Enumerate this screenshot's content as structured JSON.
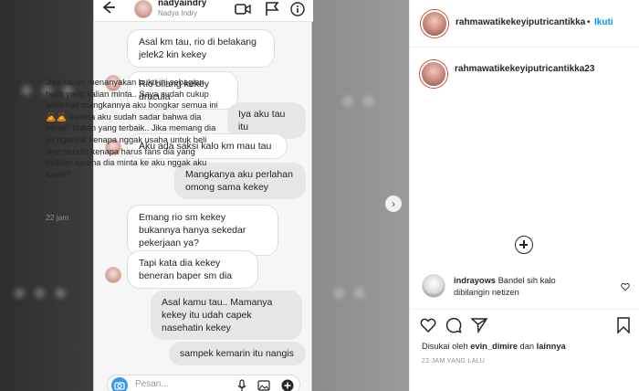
{
  "chat": {
    "header_name": "nadyaindry",
    "header_sub": "Nadya Indry",
    "messages": [
      {
        "side": "in",
        "text": "Asal km tau, rio di belakang jelek2 kin kekey"
      },
      {
        "side": "in",
        "text": "Rio bilang kekey dracula"
      },
      {
        "side": "out",
        "text": "Iya aku tau itu"
      },
      {
        "side": "in",
        "text": "Aku ada saksi kalo km mau tau"
      },
      {
        "side": "out",
        "text": "Mangkanya aku perlahan omong sama kekey"
      },
      {
        "side": "in",
        "text": "Emang rio sm kekey bukannya hanya sekedar pekerjaan ya?"
      },
      {
        "side": "in",
        "text": "Tapi kata dia kekey beneran baper sm dia"
      },
      {
        "side": "out",
        "text": "Asal kamu tau.. Mamanya kekey itu udah capek nasehatin kekey"
      },
      {
        "side": "out",
        "text": "sampek kemarin itu nangis"
      }
    ],
    "compose_placeholder": "Pesan..."
  },
  "post": {
    "username": "rahmawatikekeyiputricantikka",
    "follow_label": "Ikuti",
    "caption_username": "rahmawatikekeyiputricantikka23",
    "caption": "Jika kalian menanyakan bukti ini sebagian bukti yang kalian minta.. Saya sudah cukup sakit hati mangkannya aku bongkar semua ini🙇🙇 karena aku sudah sadar bahwa dia bener\" bukan yang terbaik.. Jika memang dia ke nganjuk kenapa nggak usaha untuk beli tiket sendiri kenapa harus fans dia yang belikan karena dia minta ke aku nggak aku kasih?",
    "time": "22 jam"
  },
  "comment": {
    "user": "indrayows",
    "text": "Bandel sih kalo dibilangin netizen"
  },
  "likes": {
    "prefix": "Disukai oleh",
    "user": "evin_dimire",
    "middle": "dan",
    "others": "lainnya"
  },
  "timestamp": "22 JAM YANG LALU",
  "colors": {
    "accent": "#0095f6",
    "camera": "#3897f0"
  },
  "icons": [
    "back-arrow-icon",
    "video-icon",
    "flag-icon",
    "next-arrow-icon",
    "add-comment-icon",
    "heart-icon",
    "comment-icon",
    "share-icon",
    "bookmark-icon",
    "camera-icon",
    "mic-icon",
    "gallery-icon",
    "plus-circle-icon"
  ]
}
